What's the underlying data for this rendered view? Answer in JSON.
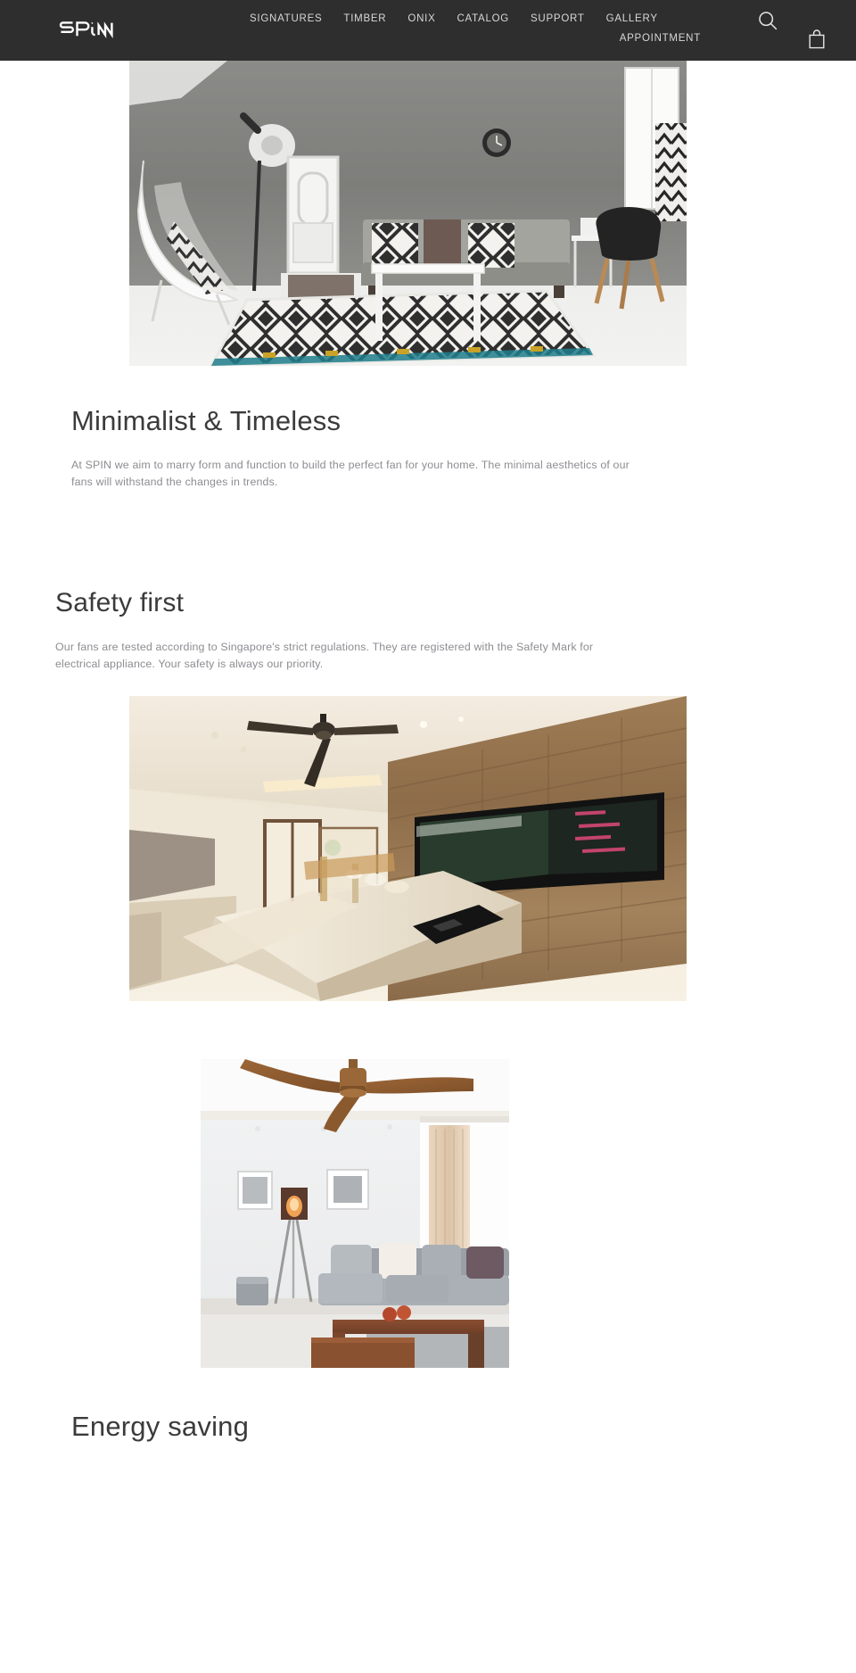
{
  "header": {
    "brand_name": "SPiN",
    "brand_alt": "SPiN logo",
    "nav_primary": [
      {
        "label": "SIGNATURES",
        "name": "nav-signatures"
      },
      {
        "label": "TIMBER",
        "name": "nav-timber"
      },
      {
        "label": "ONIX",
        "name": "nav-onix"
      },
      {
        "label": "CATALOG",
        "name": "nav-catalog"
      },
      {
        "label": "SUPPORT",
        "name": "nav-support"
      },
      {
        "label": "GALLERY",
        "name": "nav-gallery"
      }
    ],
    "nav_secondary": [
      {
        "label": "APPOINTMENT",
        "name": "nav-appointment"
      }
    ],
    "search_icon": "search-icon",
    "cart_icon": "shopping-bag-icon",
    "background_color": "#2e2e2e",
    "link_color": "#d8d8d8"
  },
  "sections": [
    {
      "id": "minimalist",
      "image_alt": "Grey concrete-wall living room with patterned rug, sofa and black chair",
      "title": "Minimalist & Timeless",
      "body": "At SPIN we aim to marry form and function to build the perfect fan for your home. The minimal aesthetics of our fans will withstand the changes in trends."
    },
    {
      "id": "safety",
      "title": "Safety first",
      "body": "Our fans are tested according to Singapore's strict regulations. They are registered with the Safety Mark for electrical appliance. Your safety is always our priority.",
      "image_alt": "Modern kitchen with wood-panelled wall and dark ceiling fan"
    },
    {
      "id": "energy",
      "image_alt": "Bright living room with wooden three-blade ceiling fan above grey sofa",
      "title": "Energy saving"
    }
  ],
  "colors": {
    "page_background": "#ffffff",
    "heading": "#3b3b3b",
    "body_text": "#8d8d93",
    "header_bar": "#2e2e2e"
  }
}
